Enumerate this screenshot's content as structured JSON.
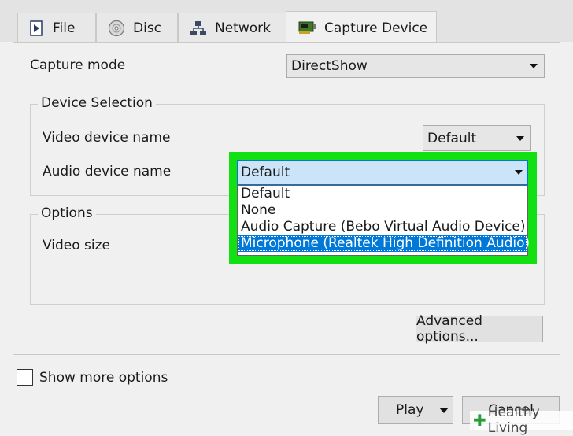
{
  "tabs": [
    {
      "label": "File",
      "icon": "file-play-icon"
    },
    {
      "label": "Disc",
      "icon": "disc-icon"
    },
    {
      "label": "Network",
      "icon": "network-icon"
    },
    {
      "label": "Capture Device",
      "icon": "capture-card-icon"
    }
  ],
  "capture_mode": {
    "label": "Capture mode",
    "value": "DirectShow"
  },
  "device_selection": {
    "title": "Device Selection",
    "video_label": "Video device name",
    "video_value": "Default",
    "audio_label": "Audio device name",
    "audio_value": "Default",
    "audio_options": [
      "Default",
      "None",
      "Audio Capture (Bebo Virtual Audio Device)",
      "Microphone (Realtek High Definition Audio)"
    ]
  },
  "options": {
    "title": "Options",
    "video_size_label": "Video size"
  },
  "advanced_label": "Advanced options...",
  "show_more_label": "Show more options",
  "play_label": "Play",
  "cancel_label": "Cancel",
  "watermark": "Healthy Living",
  "colors": {
    "highlight": "#13e013",
    "selection": "#0078d7",
    "combo_focus": "#cce4f7"
  }
}
